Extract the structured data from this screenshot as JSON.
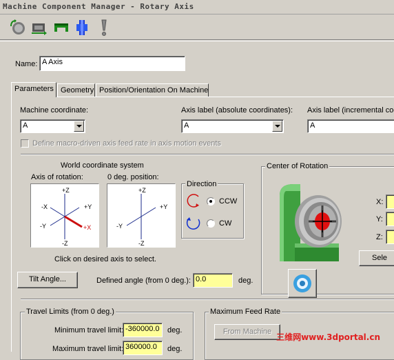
{
  "window": {
    "title": "Machine Component Manager - Rotary Axis"
  },
  "toolbar": {
    "buttons": [
      {
        "icon": "rotary-axis-icon"
      },
      {
        "icon": "linear-axis-icon"
      },
      {
        "icon": "table-icon"
      },
      {
        "icon": "head-icon"
      },
      {
        "icon": "exclamation-icon"
      }
    ]
  },
  "name_field": {
    "label": "Name:",
    "value": "A Axis"
  },
  "tabs": [
    {
      "label": "Parameters"
    },
    {
      "label": "Geometry"
    },
    {
      "label": "Position/Orientation On Machine"
    }
  ],
  "machine_coordinate": {
    "label": "Machine coordinate:",
    "value": "A"
  },
  "axis_label_abs": {
    "label": "Axis label (absolute coordinates):",
    "value": "A"
  },
  "axis_label_inc": {
    "label": "Axis label (incremental coo",
    "value": "A"
  },
  "macro_checkbox": {
    "label": "Define macro-driven axis feed rate in axis motion events"
  },
  "world_coord": {
    "title": "World coordinate system",
    "axis_rotation_label": "Axis of rotation:",
    "zero_deg_label": "0 deg. position:",
    "hint": "Click on desired axis to select."
  },
  "axis_labels": {
    "pz": "+Z",
    "nz": "-Z",
    "px": "+X",
    "nx": "-X",
    "py": "+Y",
    "ny": "-Y"
  },
  "direction": {
    "title": "Direction",
    "ccw": "CCW",
    "cw": "CW",
    "selected": "CCW"
  },
  "tilt": {
    "button": "Tilt Angle...",
    "defined_label": "Defined angle (from 0 deg.):",
    "value": "0.0",
    "unit": "deg."
  },
  "center": {
    "title": "Center of Rotation",
    "x_label": "X:",
    "y_label": "Y:",
    "z_label": "Z:",
    "select_button": "Sele"
  },
  "travel": {
    "title": "Travel Limits (from 0 deg.)",
    "min_label": "Minimum travel limit:",
    "min_value": "-360000.0",
    "min_unit": "deg.",
    "max_label": "Maximum travel limit:",
    "max_value": "360000.0",
    "max_unit": "deg."
  },
  "feed": {
    "title": "Maximum Feed Rate",
    "button": "From Machine"
  },
  "watermark": "三维网www.3dportal.cn",
  "colors": {
    "field_yellow": "#ffff99",
    "face": "#d4d0c8",
    "red_axis": "#cc1010"
  }
}
